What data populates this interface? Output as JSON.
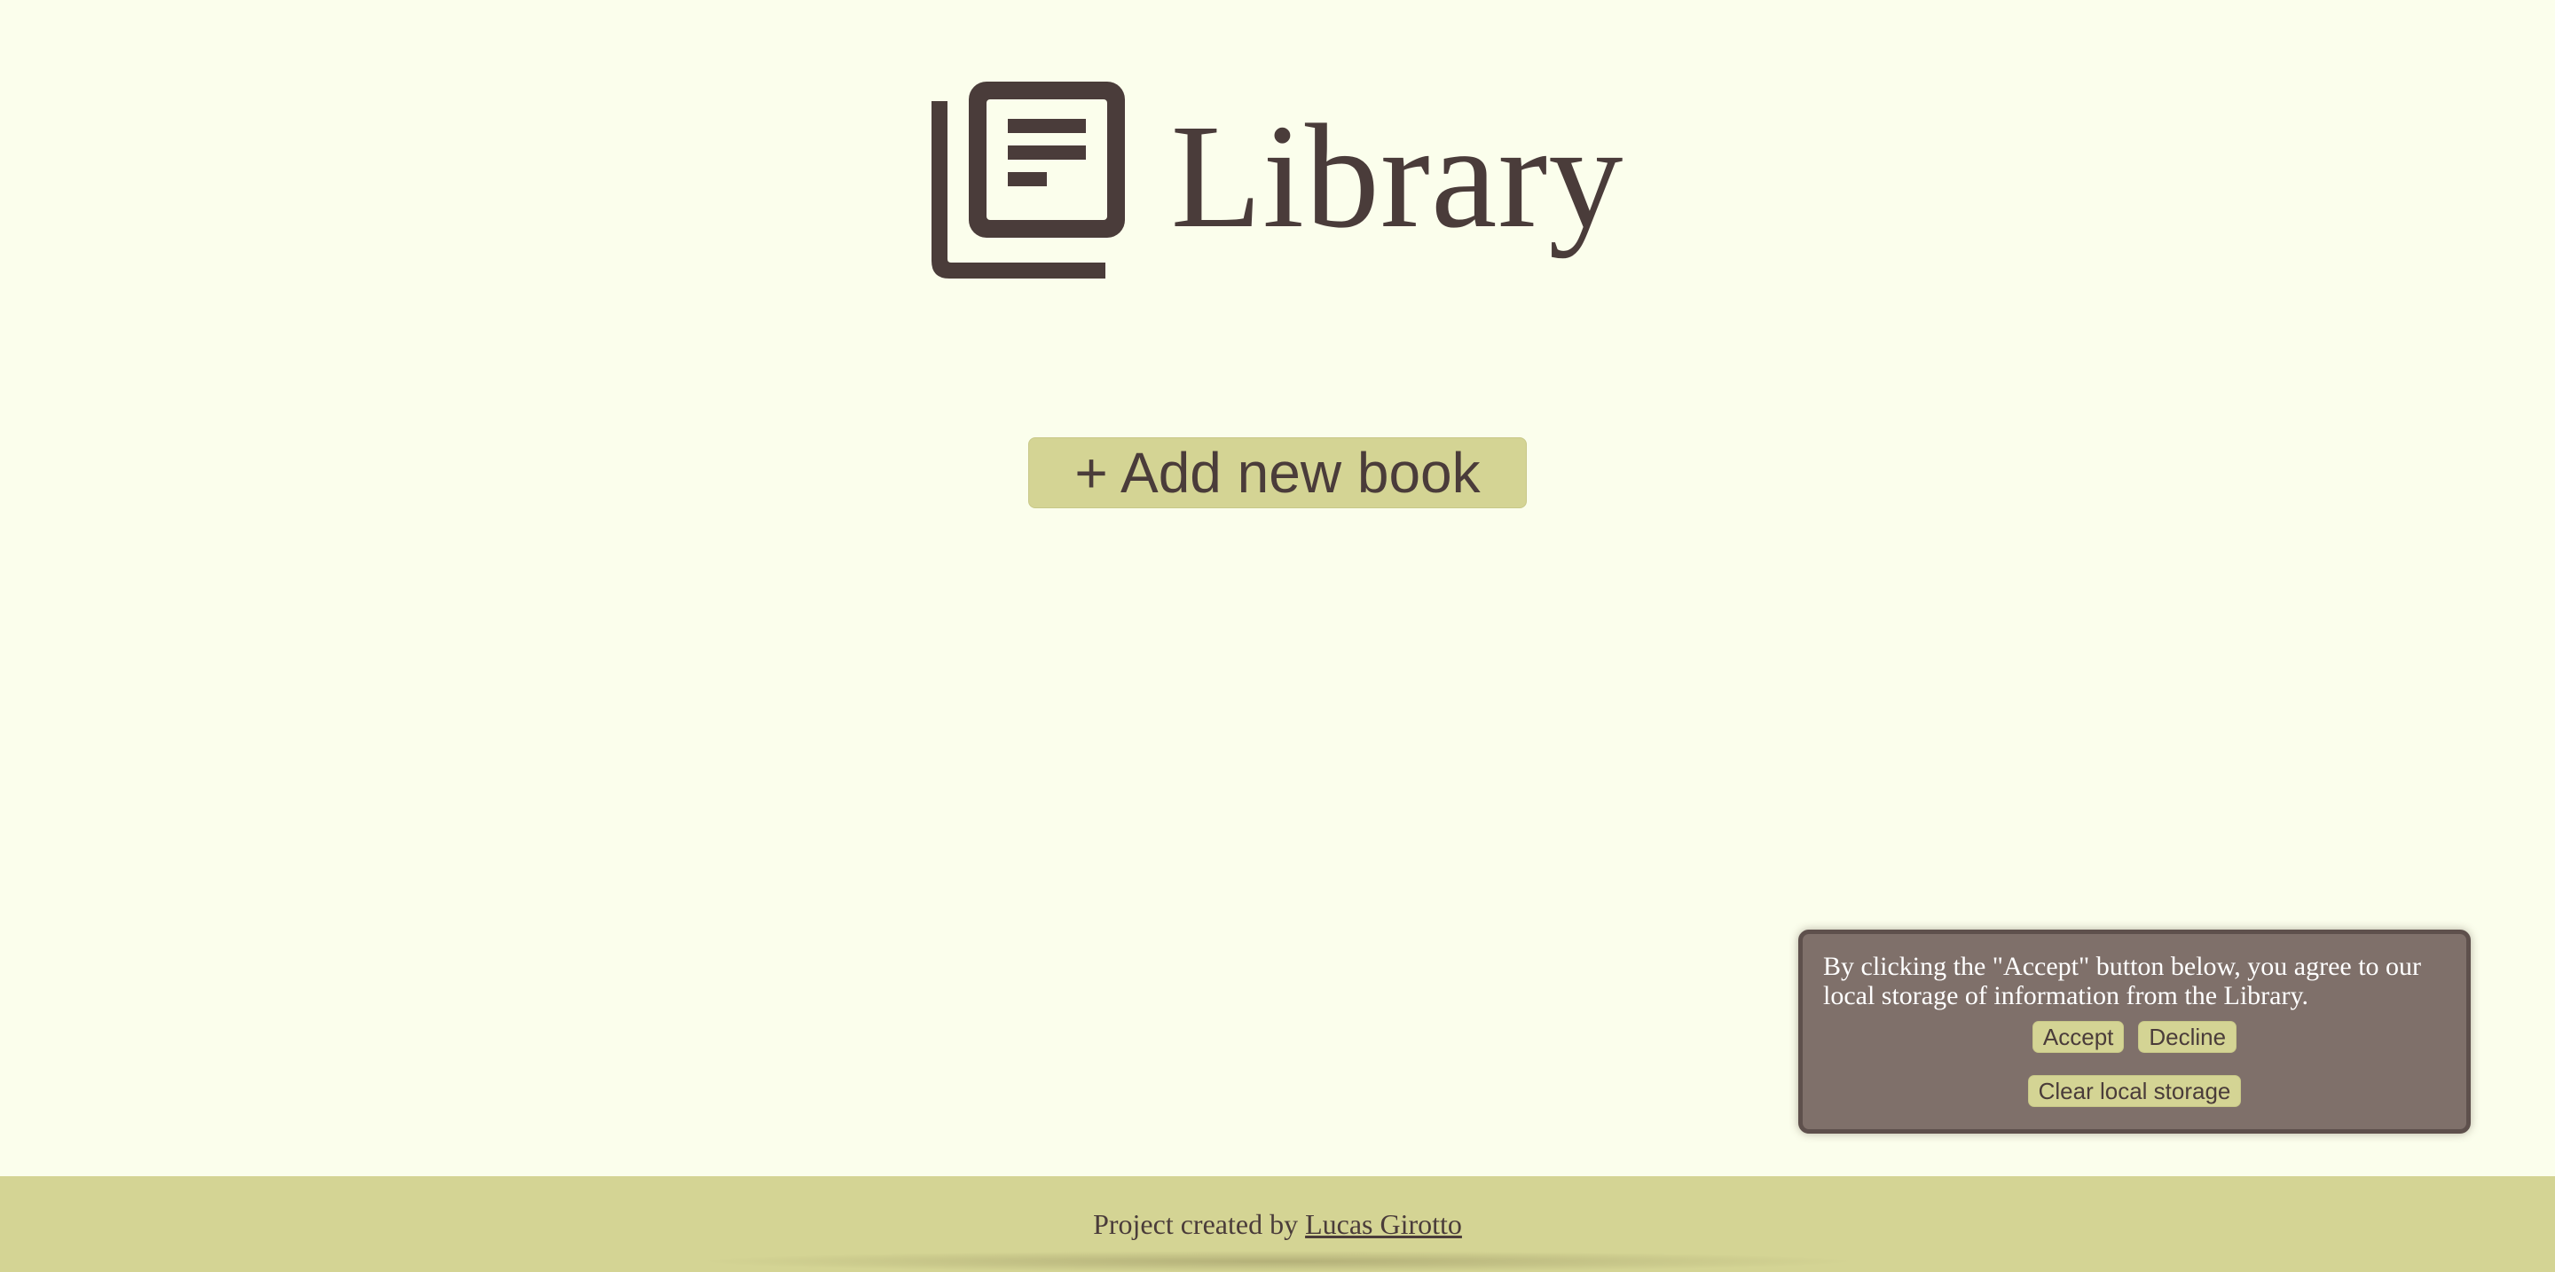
{
  "header": {
    "title": "Library",
    "logo_icon": "newspaper-stack-icon"
  },
  "main": {
    "add_button_label": "+ Add new book"
  },
  "consent": {
    "message": "By clicking the \"Accept\" button below, you agree to our local storage of information from the Library.",
    "accept_label": "Accept",
    "decline_label": "Decline",
    "clear_label": "Clear local storage"
  },
  "footer": {
    "prefix": "Project created by ",
    "author_link": "Lucas Girotto"
  },
  "colors": {
    "background": "#fbfeec",
    "accent": "#d4d494",
    "text": "#4a3c3a",
    "dialog": "#7f706a"
  }
}
